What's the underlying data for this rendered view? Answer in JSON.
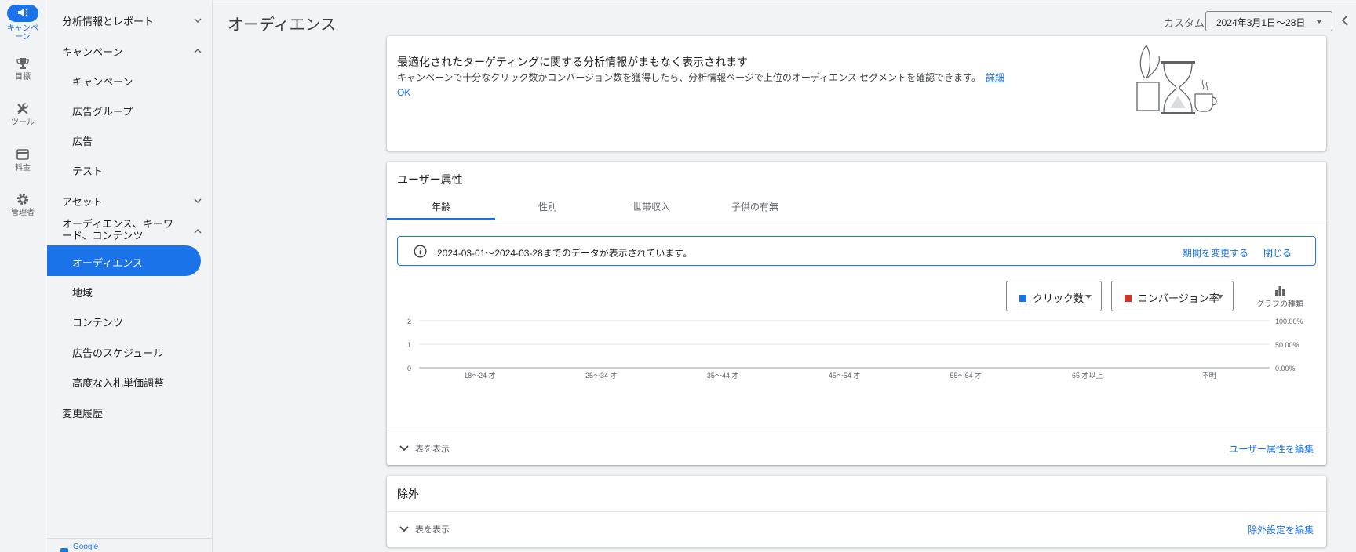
{
  "rail": {
    "items": [
      {
        "label": "キャンペーン",
        "icon": "megaphone-icon",
        "active": true
      },
      {
        "label": "目標",
        "icon": "trophy-icon",
        "active": false
      },
      {
        "label": "ツール",
        "icon": "tools-icon",
        "active": false
      },
      {
        "label": "料金",
        "icon": "credit-card-icon",
        "active": false
      },
      {
        "label": "管理者",
        "icon": "gear-icon",
        "active": false
      }
    ]
  },
  "sidebar": {
    "items": [
      {
        "label": "分析情報とレポート",
        "chevron": "down"
      },
      {
        "label": "キャンペーン",
        "chevron": "up"
      },
      {
        "label": "キャンペーン"
      },
      {
        "label": "広告グループ"
      },
      {
        "label": "広告"
      },
      {
        "label": "テスト"
      },
      {
        "label": "アセット",
        "chevron": "down"
      },
      {
        "label": "オーディエンス、キーワード、コンテンツ",
        "chevron": "up"
      },
      {
        "label": "オーディエンス",
        "active": true
      },
      {
        "label": "地域"
      },
      {
        "label": "コンテンツ"
      },
      {
        "label": "広告のスケジュール"
      },
      {
        "label": "高度な入札単価調整"
      },
      {
        "label": "変更履歴"
      }
    ],
    "footer": "Google"
  },
  "header": {
    "title": "オーディエンス",
    "range_label": "カスタム",
    "date_range": "2024年3月1日～28日"
  },
  "promo": {
    "title": "最適化されたターゲティングに関する分析情報がまもなく表示されます",
    "text": "キャンペーンで十分なクリック数かコンバージョン数を獲得したら、分析情報ページで上位のオーディエンス セグメントを確認できます。",
    "link": "詳細",
    "ok": "OK"
  },
  "demographics": {
    "title": "ユーザー属性",
    "tabs": [
      "年齢",
      "性別",
      "世帯収入",
      "子供の有無"
    ],
    "active_tab": 0,
    "banner_text": "2024-03-01～2024-03-28までのデータが表示されています。",
    "change_period": "期間を変更する",
    "close": "閉じる",
    "metric1": "クリック数",
    "metric2": "コンバージョン率",
    "chart_type_label": "グラフの種類",
    "show_table": "表を表示",
    "edit": "ユーザー属性を編集"
  },
  "exclusions": {
    "title": "除外",
    "show_table": "表を表示",
    "edit": "除外設定を編集"
  },
  "colors": {
    "accent": "#1a73e8",
    "series1": "#1a73e8",
    "series2": "#d93025"
  },
  "chart_data": {
    "type": "bar",
    "categories": [
      "18～24 才",
      "25～34 才",
      "35～44 才",
      "45～54 才",
      "55～64 才",
      "65 才以上",
      "不明"
    ],
    "series": [
      {
        "name": "クリック数",
        "values": [
          0,
          0,
          0,
          0,
          0,
          0,
          0
        ],
        "axis": "left"
      },
      {
        "name": "コンバージョン率",
        "values": [
          0,
          0,
          0,
          0,
          0,
          0,
          0
        ],
        "axis": "right"
      }
    ],
    "y_left": {
      "ticks": [
        "0",
        "1",
        "2"
      ],
      "lim": [
        0,
        2
      ]
    },
    "y_right": {
      "ticks": [
        "0.00%",
        "50.00%",
        "100.00%"
      ],
      "lim": [
        0,
        100
      ]
    },
    "grid": true
  }
}
